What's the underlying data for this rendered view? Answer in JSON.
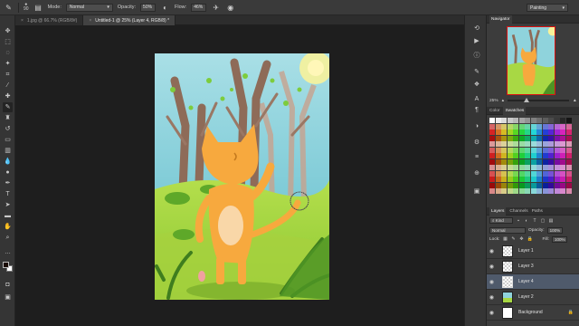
{
  "options_bar": {
    "brush_size": "90",
    "mode_label": "Mode:",
    "mode_value": "Normal",
    "opacity_label": "Opacity:",
    "opacity_value": "50%",
    "flow_label": "Flow:",
    "flow_value": "46%",
    "workspace_value": "Painting"
  },
  "tabs": [
    {
      "label": "1.jpg @ 66.7% (RGB/8#)",
      "close": "×"
    },
    {
      "label": "Untitled-1 @ 25% (Layer 4, RGB/8) *",
      "close": "×"
    }
  ],
  "navigator": {
    "tab_label": "Navigator",
    "zoom_value": "25%"
  },
  "color_panel": {
    "tabs": [
      "Color",
      "Swatches"
    ],
    "active_tab": "Swatches"
  },
  "layers_panel": {
    "tabs": [
      "Layers",
      "Channels",
      "Paths"
    ],
    "kind_label": "Kind",
    "blend_mode": "Normal",
    "opacity_label": "Opacity:",
    "opacity_value": "100%",
    "lock_label": "Lock:",
    "fill_label": "Fill:",
    "fill_value": "100%",
    "layers": [
      {
        "name": "Layer 1",
        "selected": false
      },
      {
        "name": "Layer 3",
        "selected": false
      },
      {
        "name": "Layer 4",
        "selected": true
      },
      {
        "name": "Layer 2",
        "selected": false
      },
      {
        "name": "Background",
        "selected": false
      }
    ]
  },
  "colors": {
    "foreground": "#1a0c05",
    "background": "#ffffff",
    "accent_selection": "#4f5a6b"
  }
}
